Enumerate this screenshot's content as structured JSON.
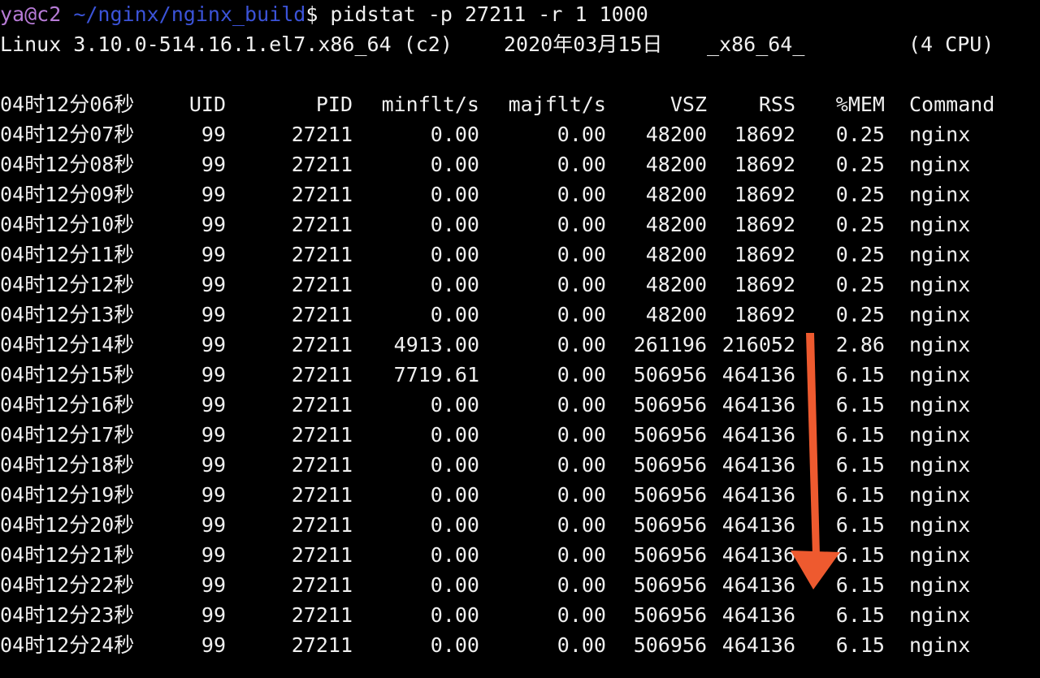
{
  "prompt": {
    "user_host": "ya@c2",
    "path": "~/nginx/nginx_build",
    "symbol": "$",
    "command": " pidstat -p 27211 -r 1 1000"
  },
  "sysinfo": {
    "kernel": "Linux 3.10.0-514.16.1.el7.x86_64 (c2)",
    "date": "2020年03月15日",
    "arch": "_x86_64_",
    "cpus": "(4 CPU)"
  },
  "table": {
    "headers": [
      "04时12分06秒",
      "UID",
      "PID",
      "minflt/s",
      "majflt/s",
      "VSZ",
      "RSS",
      "%MEM",
      "Command"
    ],
    "rows": [
      [
        "04时12分07秒",
        "99",
        "27211",
        "0.00",
        "0.00",
        "48200",
        "18692",
        "0.25",
        "nginx"
      ],
      [
        "04时12分08秒",
        "99",
        "27211",
        "0.00",
        "0.00",
        "48200",
        "18692",
        "0.25",
        "nginx"
      ],
      [
        "04时12分09秒",
        "99",
        "27211",
        "0.00",
        "0.00",
        "48200",
        "18692",
        "0.25",
        "nginx"
      ],
      [
        "04时12分10秒",
        "99",
        "27211",
        "0.00",
        "0.00",
        "48200",
        "18692",
        "0.25",
        "nginx"
      ],
      [
        "04时12分11秒",
        "99",
        "27211",
        "0.00",
        "0.00",
        "48200",
        "18692",
        "0.25",
        "nginx"
      ],
      [
        "04时12分12秒",
        "99",
        "27211",
        "0.00",
        "0.00",
        "48200",
        "18692",
        "0.25",
        "nginx"
      ],
      [
        "04时12分13秒",
        "99",
        "27211",
        "0.00",
        "0.00",
        "48200",
        "18692",
        "0.25",
        "nginx"
      ],
      [
        "04时12分14秒",
        "99",
        "27211",
        "4913.00",
        "0.00",
        "261196",
        "216052",
        "2.86",
        "nginx"
      ],
      [
        "04时12分15秒",
        "99",
        "27211",
        "7719.61",
        "0.00",
        "506956",
        "464136",
        "6.15",
        "nginx"
      ],
      [
        "04时12分16秒",
        "99",
        "27211",
        "0.00",
        "0.00",
        "506956",
        "464136",
        "6.15",
        "nginx"
      ],
      [
        "04时12分17秒",
        "99",
        "27211",
        "0.00",
        "0.00",
        "506956",
        "464136",
        "6.15",
        "nginx"
      ],
      [
        "04时12分18秒",
        "99",
        "27211",
        "0.00",
        "0.00",
        "506956",
        "464136",
        "6.15",
        "nginx"
      ],
      [
        "04时12分19秒",
        "99",
        "27211",
        "0.00",
        "0.00",
        "506956",
        "464136",
        "6.15",
        "nginx"
      ],
      [
        "04时12分20秒",
        "99",
        "27211",
        "0.00",
        "0.00",
        "506956",
        "464136",
        "6.15",
        "nginx"
      ],
      [
        "04时12分21秒",
        "99",
        "27211",
        "0.00",
        "0.00",
        "506956",
        "464136",
        "6.15",
        "nginx"
      ],
      [
        "04时12分22秒",
        "99",
        "27211",
        "0.00",
        "0.00",
        "506956",
        "464136",
        "6.15",
        "nginx"
      ],
      [
        "04时12分23秒",
        "99",
        "27211",
        "0.00",
        "0.00",
        "506956",
        "464136",
        "6.15",
        "nginx"
      ],
      [
        "04时12分24秒",
        "99",
        "27211",
        "0.00",
        "0.00",
        "506956",
        "464136",
        "6.15",
        "nginx"
      ]
    ]
  },
  "colors": {
    "background": "#000000",
    "text": "#f0f0f0",
    "user": "#b77bd6",
    "path": "#3b53d8",
    "arrow": "#ee5a2f"
  },
  "annotation": {
    "icon": "down-arrow-icon"
  }
}
